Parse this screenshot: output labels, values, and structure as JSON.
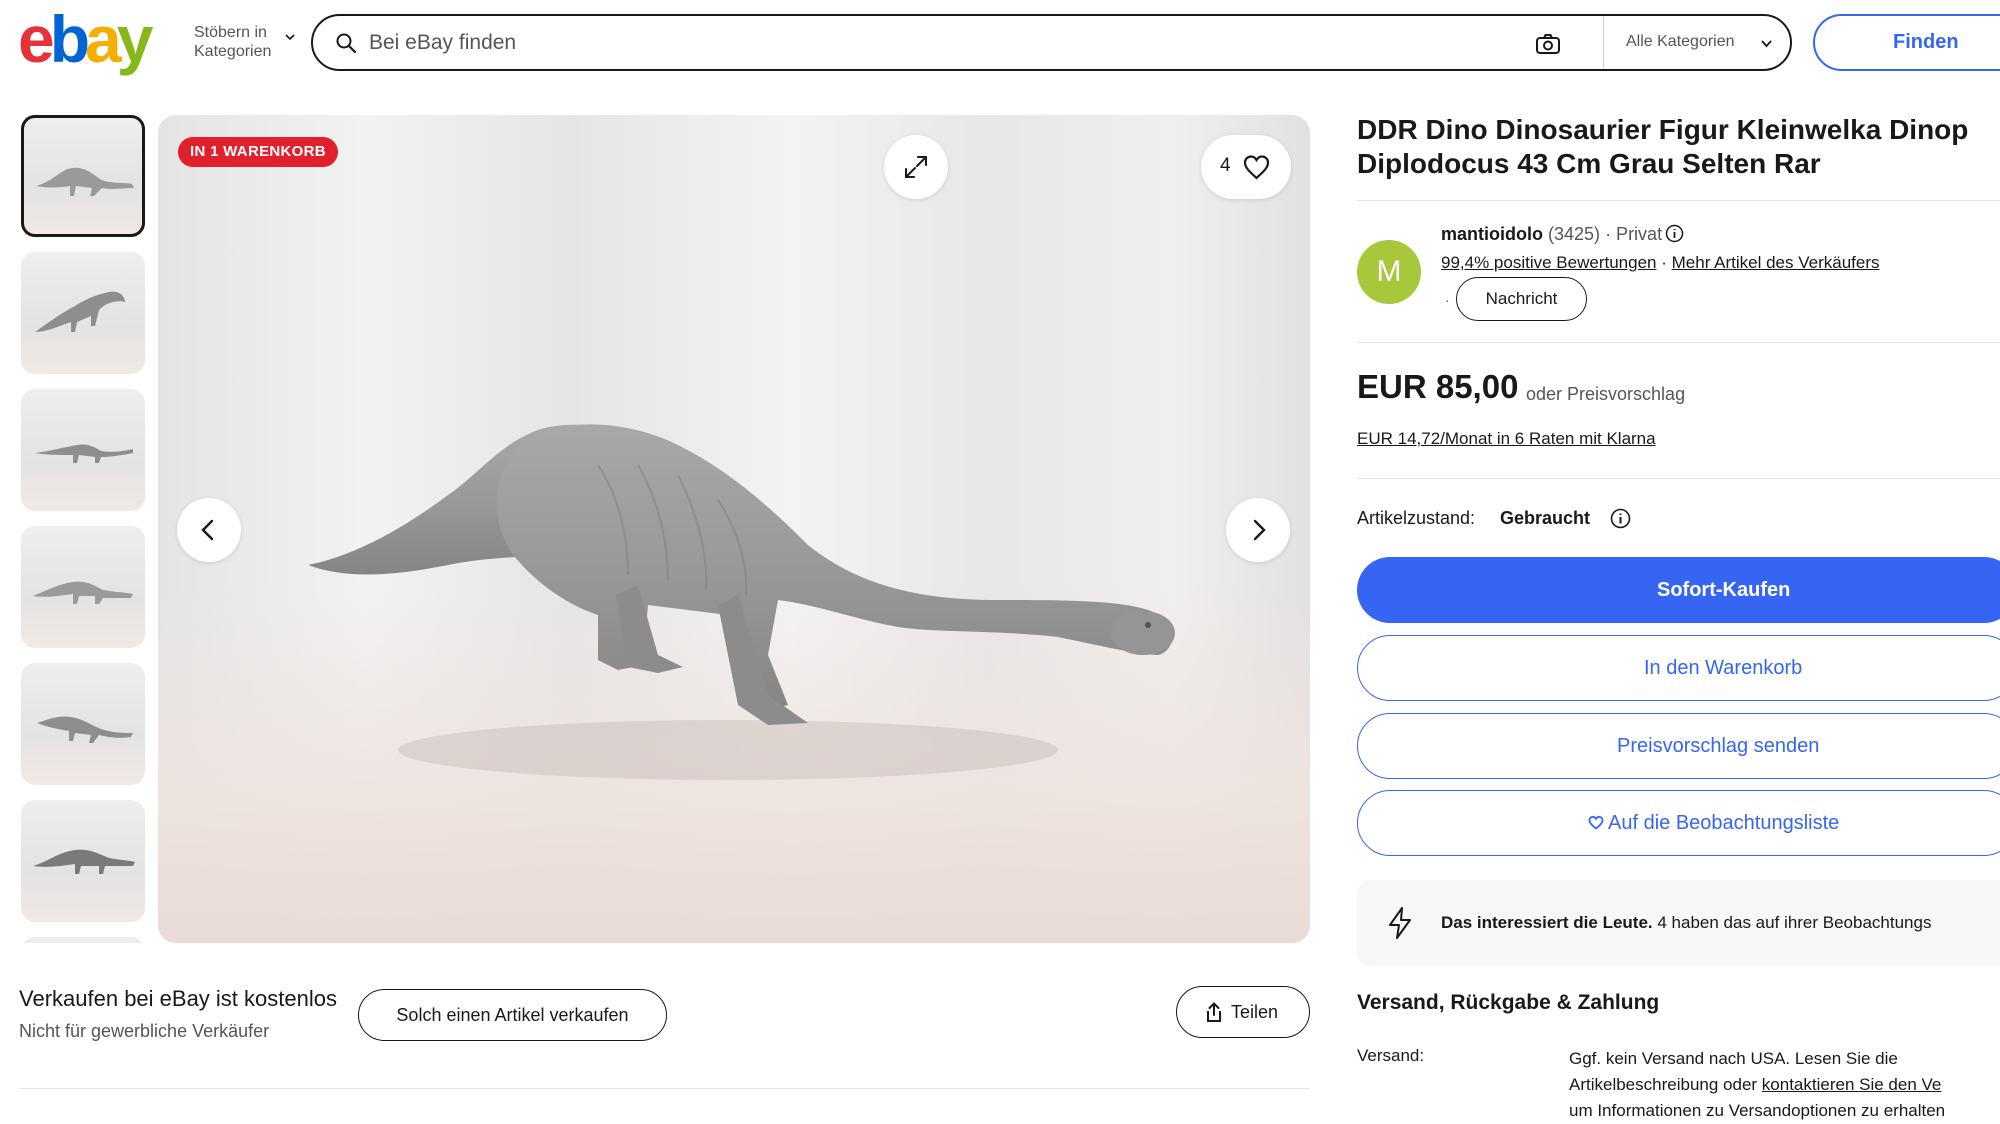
{
  "header": {
    "logo_letters": [
      {
        "char": "e",
        "color": "#e53238"
      },
      {
        "char": "b",
        "color": "#0064d2"
      },
      {
        "char": "a",
        "color": "#f5af02"
      },
      {
        "char": "y",
        "color": "#86b817"
      }
    ],
    "browse_line1": "Stöbern in",
    "browse_line2": "Kategorien",
    "search_placeholder": "Bei eBay finden",
    "category_label": "Alle Kategorien",
    "find_button": "Finden"
  },
  "gallery": {
    "thumbnail_count": 6,
    "badge": "IN 1 WARENKORB",
    "watch_count": "4"
  },
  "sell_row": {
    "title": "Verkaufen bei eBay ist kostenlos",
    "subtitle": "Nicht für gewerbliche Verkäufer",
    "sell_button": "Solch einen Artikel verkaufen",
    "share_button": "Teilen"
  },
  "listing": {
    "title_line1": "DDR Dino Dinosaurier Figur Kleinwelka Dinop",
    "title_line2": "Diplodocus 43 Cm Grau Selten Rar",
    "seller": {
      "avatar_letter": "M",
      "name": "mantioidolo",
      "count": "(3425)",
      "type": "· Privat",
      "feedback_link": "99,4% positive Bewertungen",
      "separator": "·",
      "more_link": "Mehr Artikel des Verkäufers",
      "message_dot": "·",
      "message_button": "Nachricht"
    },
    "price": "EUR 85,00",
    "price_alt": "oder Preisvorschlag",
    "klarna": "EUR 14,72/Monat in 6 Raten mit Klarna",
    "condition_label": "Artikelzustand:",
    "condition_value": "Gebraucht",
    "buy_now": "Sofort-Kaufen",
    "add_to_cart": "In den Warenkorb",
    "make_offer": "Preisvorschlag senden",
    "watchlist": "Auf die Beobachtungsliste",
    "interest_bold": "Das interessiert die Leute.",
    "interest_text": "4 haben das auf ihrer Beobachtungs",
    "shipping_heading": "Versand, Rückgabe & Zahlung",
    "shipping_label": "Versand:",
    "shipping_line1": "Ggf. kein Versand nach USA. Lesen Sie die",
    "shipping_line2_pre": "Artikelbeschreibung oder",
    "shipping_line2_link": "kontaktieren Sie den Ve",
    "shipping_line3": "um Informationen zu Versandoptionen zu erhalten"
  },
  "colors": {
    "primary_blue": "#3665f3",
    "badge_red": "#e0212d",
    "avatar_green": "#a7c83b"
  },
  "icons": [
    "search-icon",
    "camera-icon",
    "chevron-down-icon",
    "expand-icon",
    "heart-icon",
    "chevron-left-icon",
    "chevron-right-icon",
    "share-icon",
    "info-icon",
    "bolt-icon"
  ]
}
